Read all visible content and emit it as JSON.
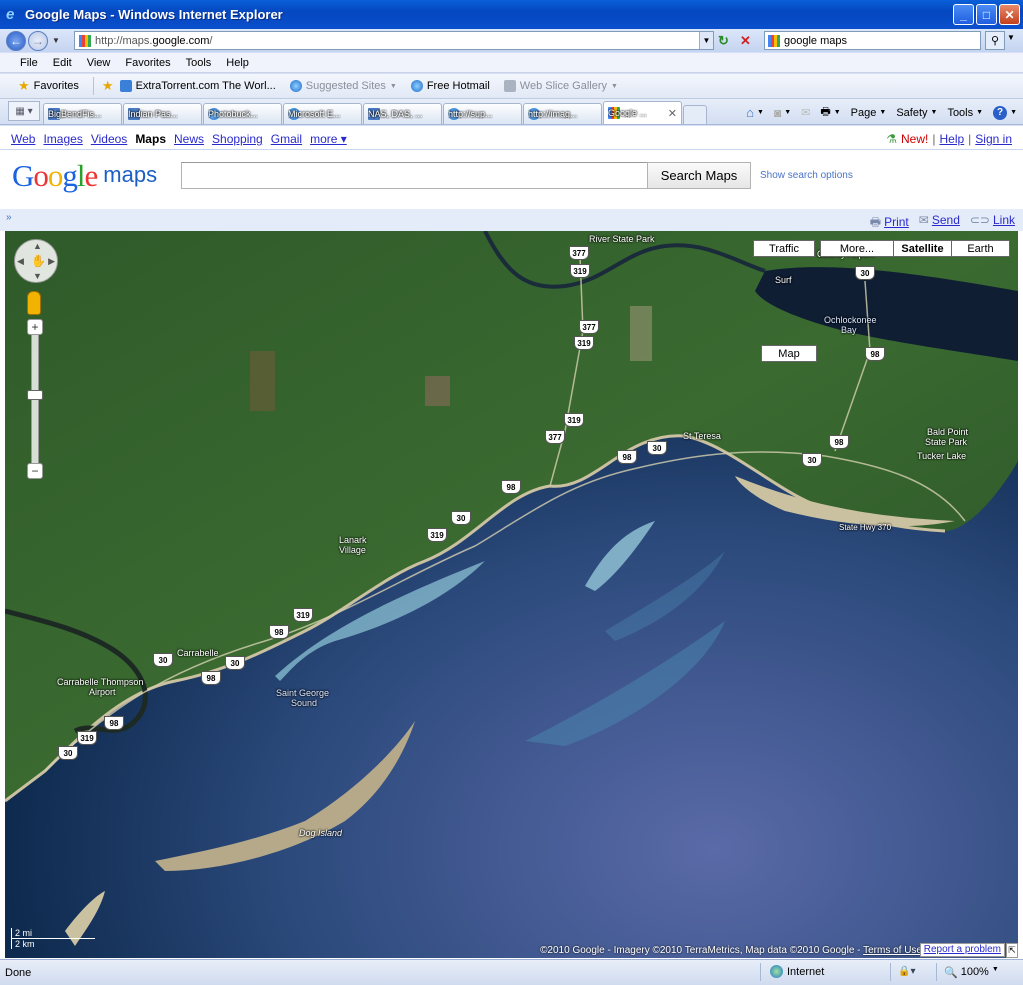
{
  "window": {
    "title": "Google Maps - Windows Internet Explorer"
  },
  "address": {
    "prefix": "http://maps.",
    "domain": "google.com",
    "suffix": "/"
  },
  "search": {
    "value": "google maps"
  },
  "menu": [
    "File",
    "Edit",
    "View",
    "Favorites",
    "Tools",
    "Help"
  ],
  "favorites": {
    "label": "Favorites",
    "items": [
      "ExtraTorrent.com The Worl...",
      "Suggested Sites",
      "Free Hotmail",
      "Web Slice Gallery"
    ]
  },
  "tabs": [
    "BigBendFis...",
    "Indian Pas...",
    "Photobuck...",
    "Microsoft E...",
    "NAS, DAS, ...",
    "http://sup...",
    "http://imag...",
    "Google ..."
  ],
  "commands": {
    "page": "Page",
    "safety": "Safety",
    "tools": "Tools"
  },
  "gbar": {
    "links": [
      "Web",
      "Images",
      "Videos",
      "Maps",
      "News",
      "Shopping",
      "Gmail",
      "more"
    ],
    "current": "Maps",
    "new_label": "New!",
    "help": "Help",
    "signin": "Sign in"
  },
  "logo": {
    "word": "Google",
    "product": "maps"
  },
  "searchbar": {
    "button": "Search Maps",
    "options": "Show search options",
    "value": ""
  },
  "subbar": {
    "print": "Print",
    "send": "Send",
    "link": "Link"
  },
  "map": {
    "types": {
      "traffic": "Traffic",
      "more": "More...",
      "map": "Map",
      "satellite": "Satellite",
      "earth": "Earth",
      "selected": "Satellite"
    },
    "places": [
      "River State Park",
      "County Airport",
      "Ochlockonee",
      "Bay",
      "Bald Point",
      "State Park",
      "Tucker Lake",
      "St Teresa",
      "State Hwy 370",
      "Lanark",
      "Village",
      "Carrabelle",
      "Carrabelle Thompson",
      "Airport",
      "Saint George",
      "Sound",
      "Dog Island",
      "Surf"
    ],
    "routes": [
      "377",
      "319",
      "377",
      "319",
      "319",
      "377",
      "98",
      "30",
      "98",
      "30",
      "30",
      "98",
      "98",
      "30",
      "319",
      "319",
      "98",
      "30",
      "30",
      "98",
      "98",
      "319",
      "30",
      "30"
    ],
    "scale": {
      "miles": "2 mi",
      "km": "2 km"
    },
    "copyright": "©2010 Google - Imagery ©2010 TerraMetrics, Map data ©2010 Google - ",
    "terms": "Terms of Use",
    "report": "Report a problem"
  },
  "status": {
    "text": "Done",
    "zone": "Internet",
    "zoom": "100%"
  }
}
